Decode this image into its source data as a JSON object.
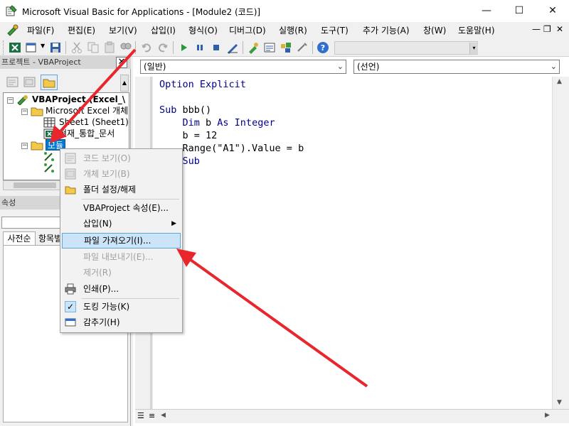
{
  "window": {
    "title": "Microsoft Visual Basic for Applications - [Module2 (코드)]",
    "buttons": {
      "minimize": "—",
      "maximize": "☐",
      "close": "✕"
    }
  },
  "menubar": {
    "items": [
      "파일(F)",
      "편집(E)",
      "보기(V)",
      "삽입(I)",
      "형식(O)",
      "디버그(D)",
      "실행(R)",
      "도구(T)",
      "추가 기능(A)",
      "창(W)",
      "도움말(H)"
    ],
    "mdi_buttons": {
      "minimize": "—",
      "restore": "❐",
      "close": "✕"
    }
  },
  "project_pane": {
    "title": "프로젝트 - VBAProject",
    "close": "✕",
    "tree": {
      "root": "VBAProject (Excel_\\",
      "excel_folder": "Microsoft Excel 개체",
      "sheet1": "Sheet1 (Sheet1)",
      "thisworkbook": "현재_통합_문서",
      "modules_folder": "모듈"
    }
  },
  "properties_pane": {
    "title": "속성",
    "tabs": [
      "사전순",
      "항목별"
    ]
  },
  "code_window": {
    "object_combo": "(일반)",
    "proc_combo": "(선언)",
    "lines": [
      "Option Explicit",
      "",
      "Sub bbb()",
      "    Dim b As Integer",
      "    b = 12",
      "    Range(\"A1\").Value = b",
      "    Sub"
    ]
  },
  "context_menu": {
    "items": [
      {
        "label": "코드 보기(O)",
        "enabled": false
      },
      {
        "label": "개체 보기(B)",
        "enabled": false
      },
      {
        "label": "폴더 설정/해제",
        "enabled": true
      },
      {
        "label": "VBAProject 속성(E)...",
        "enabled": true
      },
      {
        "label": "삽입(N)",
        "enabled": true,
        "submenu": true
      },
      {
        "label": "파일 가져오기(I)...",
        "enabled": true,
        "highlighted": true
      },
      {
        "label": "파일 내보내기(E)...",
        "enabled": false
      },
      {
        "label": "제거(R)",
        "enabled": false
      },
      {
        "label": "인쇄(P)...",
        "enabled": true
      },
      {
        "label": "도킹 가능(K)",
        "enabled": true,
        "checked": true
      },
      {
        "label": "감추기(H)",
        "enabled": true
      }
    ]
  },
  "annotation": {
    "arrow_color": "#e8262c"
  }
}
